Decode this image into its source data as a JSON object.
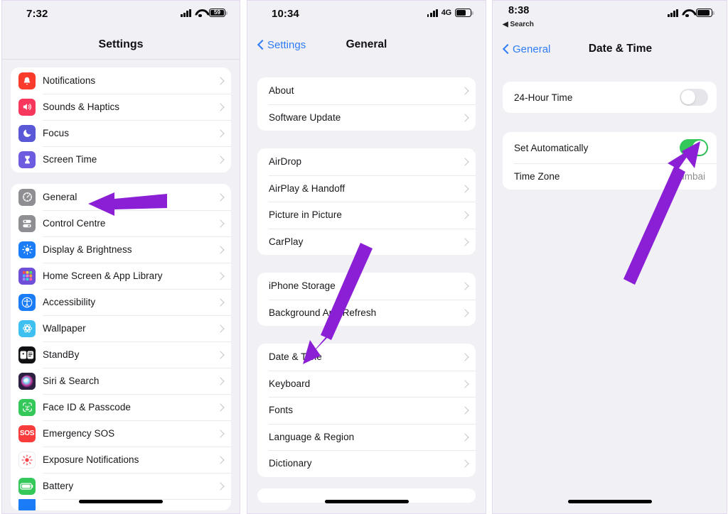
{
  "accent": {
    "purple": "#8a1fd6",
    "blue": "#2f7cf6",
    "green": "#34c759",
    "chevron": "#c3c3c8"
  },
  "panels": [
    {
      "id": "settings-root",
      "status": {
        "time": "7:32",
        "carrier": "",
        "battery_pct": "59",
        "battery_shows_number": true,
        "left_app": ""
      },
      "nav": {
        "back": "",
        "title": "Settings"
      },
      "groups": [
        {
          "rows": [
            {
              "label": "Notifications",
              "icon": "notifications-icon",
              "icon_bg": "#fa3c2d",
              "accessory": "chevron"
            },
            {
              "label": "Sounds & Haptics",
              "icon": "sounds-haptics-icon",
              "icon_bg": "#f7385c",
              "accessory": "chevron"
            },
            {
              "label": "Focus",
              "icon": "focus-icon",
              "icon_bg": "#5a58d6",
              "accessory": "chevron"
            },
            {
              "label": "Screen Time",
              "icon": "screen-time-icon",
              "icon_bg": "#6d5ce0",
              "accessory": "chevron"
            }
          ]
        },
        {
          "rows": [
            {
              "label": "General",
              "icon": "general-gear-icon",
              "icon_bg": "#8e8e93",
              "accessory": "chevron"
            },
            {
              "label": "Control Centre",
              "icon": "control-centre-icon",
              "icon_bg": "#8e8e93",
              "accessory": "chevron"
            },
            {
              "label": "Display & Brightness",
              "icon": "display-brightness-icon",
              "icon_bg": "#1a7cf7",
              "accessory": "chevron"
            },
            {
              "label": "Home Screen & App Library",
              "icon": "home-screen-icon",
              "icon_bg": "#6f4fd8",
              "accessory": "chevron"
            },
            {
              "label": "Accessibility",
              "icon": "accessibility-icon",
              "icon_bg": "#1a7cf7",
              "accessory": "chevron"
            },
            {
              "label": "Wallpaper",
              "icon": "wallpaper-icon",
              "icon_bg": "#3ec0f0",
              "accessory": "chevron"
            },
            {
              "label": "StandBy",
              "icon": "standby-icon",
              "icon_bg": "#111114",
              "accessory": "chevron"
            },
            {
              "label": "Siri & Search",
              "icon": "siri-search-icon",
              "icon_bg": "#2b2040",
              "accessory": "chevron"
            },
            {
              "label": "Face ID & Passcode",
              "icon": "face-id-icon",
              "icon_bg": "#34c759",
              "accessory": "chevron"
            },
            {
              "label": "Emergency SOS",
              "icon": "emergency-sos-icon",
              "icon_bg": "#fa3c3c",
              "accessory": "chevron"
            },
            {
              "label": "Exposure Notifications",
              "icon": "exposure-notifications-icon",
              "icon_bg": "#ffffff",
              "accessory": "chevron"
            },
            {
              "label": "Battery",
              "icon": "battery-icon",
              "icon_bg": "#34c759",
              "accessory": "chevron"
            }
          ]
        }
      ]
    },
    {
      "id": "general",
      "status": {
        "time": "10:34",
        "carrier": "4G",
        "battery_pct": "",
        "battery_shows_number": false,
        "left_app": ""
      },
      "nav": {
        "back": "Settings",
        "title": "General"
      },
      "groups": [
        {
          "rows": [
            {
              "label": "About",
              "accessory": "chevron"
            },
            {
              "label": "Software Update",
              "accessory": "chevron"
            }
          ]
        },
        {
          "rows": [
            {
              "label": "AirDrop",
              "accessory": "chevron"
            },
            {
              "label": "AirPlay & Handoff",
              "accessory": "chevron"
            },
            {
              "label": "Picture in Picture",
              "accessory": "chevron"
            },
            {
              "label": "CarPlay",
              "accessory": "chevron"
            }
          ]
        },
        {
          "rows": [
            {
              "label": "iPhone Storage",
              "accessory": "chevron"
            },
            {
              "label": "Background App Refresh",
              "accessory": "chevron"
            }
          ]
        },
        {
          "rows": [
            {
              "label": "Date & Time",
              "accessory": "chevron"
            },
            {
              "label": "Keyboard",
              "accessory": "chevron"
            },
            {
              "label": "Fonts",
              "accessory": "chevron"
            },
            {
              "label": "Language & Region",
              "accessory": "chevron"
            },
            {
              "label": "Dictionary",
              "accessory": "chevron"
            }
          ]
        }
      ]
    },
    {
      "id": "date-time",
      "status": {
        "time": "8:38",
        "carrier": "",
        "battery_pct": "",
        "battery_shows_number": false,
        "left_app": "Search"
      },
      "nav": {
        "back": "General",
        "title": "Date & Time"
      },
      "groups": [
        {
          "rows": [
            {
              "label": "24-Hour Time",
              "accessory": "toggle",
              "toggle_on": false
            }
          ]
        },
        {
          "rows": [
            {
              "label": "Set Automatically",
              "accessory": "toggle",
              "toggle_on": true
            },
            {
              "label": "Time Zone",
              "value": "Mumbai",
              "accessory": "value"
            }
          ]
        }
      ]
    }
  ],
  "annotations": [
    {
      "name": "arrow-to-general",
      "points_to": "General"
    },
    {
      "name": "arrow-to-date-and-time",
      "points_to": "Date & Time"
    },
    {
      "name": "arrow-to-set-automatically-toggle",
      "points_to": "Set Automatically"
    }
  ]
}
